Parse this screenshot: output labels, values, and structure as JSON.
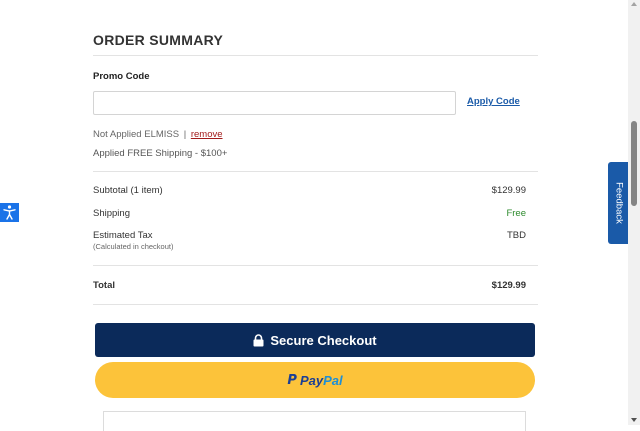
{
  "summary": {
    "title": "ORDER SUMMARY",
    "promo_label": "Promo Code",
    "promo_value": "",
    "promo_placeholder": "",
    "apply_label": "Apply Code",
    "promo_status_text": "Not Applied ELMISS",
    "promo_status_sep": "|",
    "remove_label": "remove",
    "applied_text": "Applied FREE Shipping - $100+"
  },
  "totals": {
    "subtotal_label": "Subtotal (1 item)",
    "subtotal_value": "$129.99",
    "shipping_label": "Shipping",
    "shipping_value": "Free",
    "tax_label": "Estimated Tax",
    "tax_note": "(Calculated in checkout)",
    "tax_value": "TBD",
    "total_label": "Total",
    "total_value": "$129.99"
  },
  "buttons": {
    "checkout_label": "Secure Checkout",
    "checkout_icon": "lock-icon",
    "paypal_part1": "Pay",
    "paypal_part2": "Pal",
    "paypal_icon": "paypal-logo"
  },
  "side": {
    "feedback_label": "Feedback",
    "accessibility_icon": "accessibility-icon"
  },
  "colors": {
    "checkout_bg": "#0b2a5a",
    "paypal_bg": "#fcc33a",
    "link_blue": "#1a5aa8",
    "remove_red": "#a31c1c",
    "free_green": "#2e8b2e",
    "feedback_bg": "#1a5aa8"
  }
}
